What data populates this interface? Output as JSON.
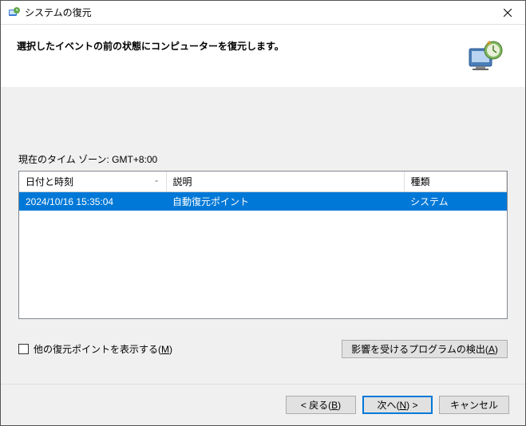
{
  "window": {
    "title": "システムの復元"
  },
  "header": {
    "text": "選択したイベントの前の状態にコンピューターを復元します。"
  },
  "content": {
    "timezone_label": "現在のタイム ゾーン: GMT+8:00",
    "columns": {
      "date": "日付と時刻",
      "desc": "説明",
      "type": "種類"
    },
    "rows": [
      {
        "date": "2024/10/16 15:35:04",
        "desc": "自動復元ポイント",
        "type": "システム"
      }
    ],
    "show_more_label_pre": "他の復元ポイントを表示する(",
    "show_more_key": "M",
    "show_more_label_post": ")",
    "scan_label_pre": "影響を受けるプログラムの検出(",
    "scan_key": "A",
    "scan_label_post": ")"
  },
  "footer": {
    "back_pre": "< 戻る(",
    "back_key": "B",
    "back_post": ")",
    "next_pre": "次へ(",
    "next_key": "N",
    "next_post": ") >",
    "cancel": "キャンセル"
  }
}
